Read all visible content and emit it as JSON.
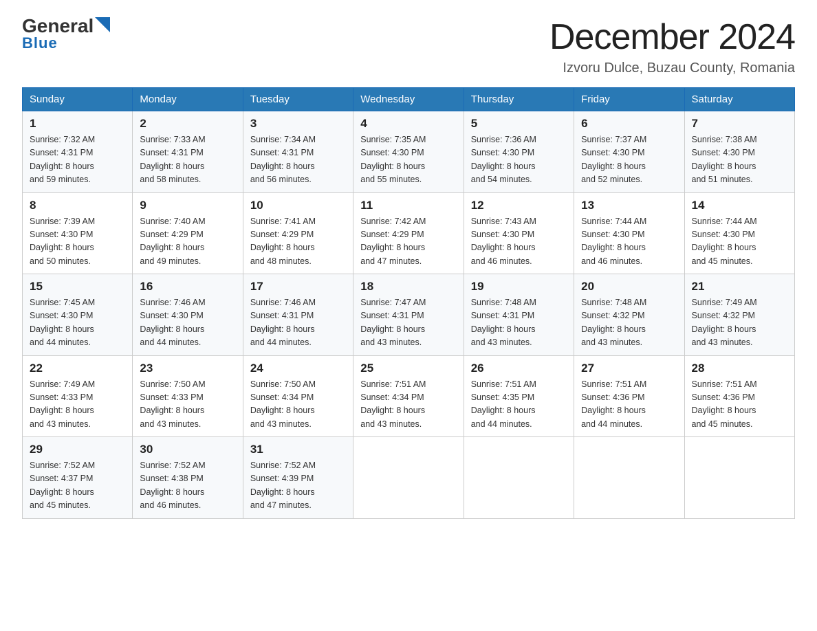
{
  "header": {
    "logo_line1": "General",
    "logo_line2": "Blue",
    "month_title": "December 2024",
    "location": "Izvoru Dulce, Buzau County, Romania"
  },
  "days_of_week": [
    "Sunday",
    "Monday",
    "Tuesday",
    "Wednesday",
    "Thursday",
    "Friday",
    "Saturday"
  ],
  "weeks": [
    [
      {
        "day": "1",
        "info": "Sunrise: 7:32 AM\nSunset: 4:31 PM\nDaylight: 8 hours\nand 59 minutes."
      },
      {
        "day": "2",
        "info": "Sunrise: 7:33 AM\nSunset: 4:31 PM\nDaylight: 8 hours\nand 58 minutes."
      },
      {
        "day": "3",
        "info": "Sunrise: 7:34 AM\nSunset: 4:31 PM\nDaylight: 8 hours\nand 56 minutes."
      },
      {
        "day": "4",
        "info": "Sunrise: 7:35 AM\nSunset: 4:30 PM\nDaylight: 8 hours\nand 55 minutes."
      },
      {
        "day": "5",
        "info": "Sunrise: 7:36 AM\nSunset: 4:30 PM\nDaylight: 8 hours\nand 54 minutes."
      },
      {
        "day": "6",
        "info": "Sunrise: 7:37 AM\nSunset: 4:30 PM\nDaylight: 8 hours\nand 52 minutes."
      },
      {
        "day": "7",
        "info": "Sunrise: 7:38 AM\nSunset: 4:30 PM\nDaylight: 8 hours\nand 51 minutes."
      }
    ],
    [
      {
        "day": "8",
        "info": "Sunrise: 7:39 AM\nSunset: 4:30 PM\nDaylight: 8 hours\nand 50 minutes."
      },
      {
        "day": "9",
        "info": "Sunrise: 7:40 AM\nSunset: 4:29 PM\nDaylight: 8 hours\nand 49 minutes."
      },
      {
        "day": "10",
        "info": "Sunrise: 7:41 AM\nSunset: 4:29 PM\nDaylight: 8 hours\nand 48 minutes."
      },
      {
        "day": "11",
        "info": "Sunrise: 7:42 AM\nSunset: 4:29 PM\nDaylight: 8 hours\nand 47 minutes."
      },
      {
        "day": "12",
        "info": "Sunrise: 7:43 AM\nSunset: 4:30 PM\nDaylight: 8 hours\nand 46 minutes."
      },
      {
        "day": "13",
        "info": "Sunrise: 7:44 AM\nSunset: 4:30 PM\nDaylight: 8 hours\nand 46 minutes."
      },
      {
        "day": "14",
        "info": "Sunrise: 7:44 AM\nSunset: 4:30 PM\nDaylight: 8 hours\nand 45 minutes."
      }
    ],
    [
      {
        "day": "15",
        "info": "Sunrise: 7:45 AM\nSunset: 4:30 PM\nDaylight: 8 hours\nand 44 minutes."
      },
      {
        "day": "16",
        "info": "Sunrise: 7:46 AM\nSunset: 4:30 PM\nDaylight: 8 hours\nand 44 minutes."
      },
      {
        "day": "17",
        "info": "Sunrise: 7:46 AM\nSunset: 4:31 PM\nDaylight: 8 hours\nand 44 minutes."
      },
      {
        "day": "18",
        "info": "Sunrise: 7:47 AM\nSunset: 4:31 PM\nDaylight: 8 hours\nand 43 minutes."
      },
      {
        "day": "19",
        "info": "Sunrise: 7:48 AM\nSunset: 4:31 PM\nDaylight: 8 hours\nand 43 minutes."
      },
      {
        "day": "20",
        "info": "Sunrise: 7:48 AM\nSunset: 4:32 PM\nDaylight: 8 hours\nand 43 minutes."
      },
      {
        "day": "21",
        "info": "Sunrise: 7:49 AM\nSunset: 4:32 PM\nDaylight: 8 hours\nand 43 minutes."
      }
    ],
    [
      {
        "day": "22",
        "info": "Sunrise: 7:49 AM\nSunset: 4:33 PM\nDaylight: 8 hours\nand 43 minutes."
      },
      {
        "day": "23",
        "info": "Sunrise: 7:50 AM\nSunset: 4:33 PM\nDaylight: 8 hours\nand 43 minutes."
      },
      {
        "day": "24",
        "info": "Sunrise: 7:50 AM\nSunset: 4:34 PM\nDaylight: 8 hours\nand 43 minutes."
      },
      {
        "day": "25",
        "info": "Sunrise: 7:51 AM\nSunset: 4:34 PM\nDaylight: 8 hours\nand 43 minutes."
      },
      {
        "day": "26",
        "info": "Sunrise: 7:51 AM\nSunset: 4:35 PM\nDaylight: 8 hours\nand 44 minutes."
      },
      {
        "day": "27",
        "info": "Sunrise: 7:51 AM\nSunset: 4:36 PM\nDaylight: 8 hours\nand 44 minutes."
      },
      {
        "day": "28",
        "info": "Sunrise: 7:51 AM\nSunset: 4:36 PM\nDaylight: 8 hours\nand 45 minutes."
      }
    ],
    [
      {
        "day": "29",
        "info": "Sunrise: 7:52 AM\nSunset: 4:37 PM\nDaylight: 8 hours\nand 45 minutes."
      },
      {
        "day": "30",
        "info": "Sunrise: 7:52 AM\nSunset: 4:38 PM\nDaylight: 8 hours\nand 46 minutes."
      },
      {
        "day": "31",
        "info": "Sunrise: 7:52 AM\nSunset: 4:39 PM\nDaylight: 8 hours\nand 47 minutes."
      },
      {
        "day": "",
        "info": ""
      },
      {
        "day": "",
        "info": ""
      },
      {
        "day": "",
        "info": ""
      },
      {
        "day": "",
        "info": ""
      }
    ]
  ]
}
